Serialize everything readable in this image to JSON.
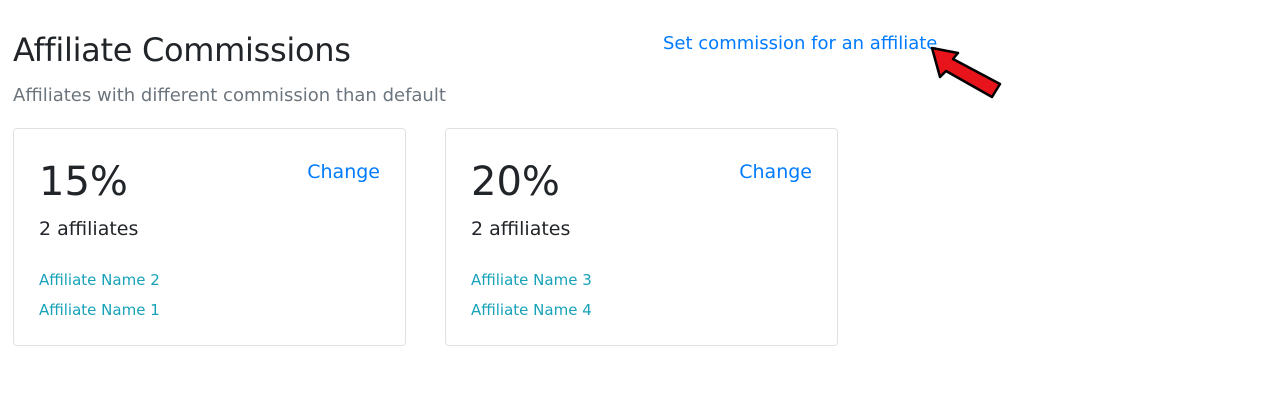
{
  "header": {
    "title": "Affiliate Commissions",
    "subtitle": "Affiliates with different commission than default",
    "set_commission_link": "Set commission for an affiliate"
  },
  "annotation": {
    "icon": "arrow-pointer-icon",
    "color": "#e8141b"
  },
  "colors": {
    "link": "#007bff",
    "affiliate_link": "#17a2b8",
    "muted": "#6c757d",
    "text": "#212529",
    "border": "#dfe2e5"
  },
  "cards": [
    {
      "rate": "15%",
      "change_label": "Change",
      "count": "2 affiliates",
      "affiliates": [
        "Affiliate Name 2",
        "Affiliate Name 1"
      ]
    },
    {
      "rate": "20%",
      "change_label": "Change",
      "count": "2 affiliates",
      "affiliates": [
        "Affiliate Name 3",
        "Affiliate Name 4"
      ]
    }
  ]
}
